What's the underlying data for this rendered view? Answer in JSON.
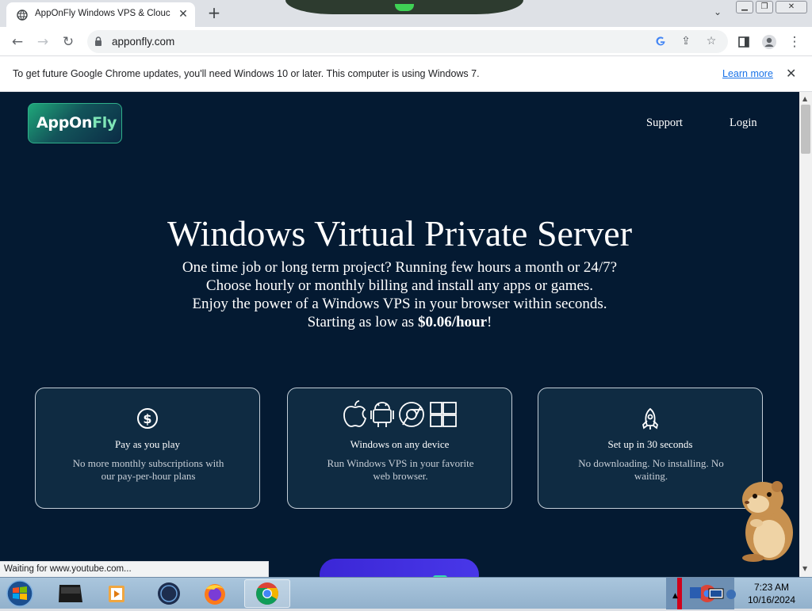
{
  "browser": {
    "tab_title": "AppOnFly Windows VPS & Clouc",
    "tab_close": "✕",
    "new_tab": "+",
    "url": "apponfly.com",
    "nav": {
      "back": "←",
      "forward": "→",
      "reload": "↻"
    },
    "infobar": {
      "message": "To get future Google Chrome updates, you'll need Windows 10 or later. This computer is using Windows 7.",
      "link": "Learn more",
      "close": "✕"
    },
    "status_text": "Waiting for www.youtube.com..."
  },
  "page": {
    "logo": {
      "part1": "AppOn",
      "part2": "Fly"
    },
    "nav": {
      "support": "Support",
      "login": "Login"
    },
    "hero": {
      "title": "Windows Virtual Private Server",
      "line1": "One time job or long term project? Running few hours a month or 24/7?",
      "line2": "Choose hourly or monthly billing and install any apps or games.",
      "line3": "Enjoy the power of a Windows VPS in your browser within seconds.",
      "line4_prefix": "Starting as low as ",
      "line4_price": "$0.06/hour",
      "line4_suffix": "!"
    },
    "cards": [
      {
        "icon": "dollar-icon",
        "title": "Pay as you play",
        "desc": "No more monthly subscriptions with our pay-per-hour plans"
      },
      {
        "icon": "platforms-icon",
        "title": "Windows on any device",
        "desc": "Run Windows VPS in your favorite web browser."
      },
      {
        "icon": "rocket-icon",
        "title": "Set up in 30 seconds",
        "desc": "No downloading. No installing. No waiting."
      }
    ]
  },
  "taskbar": {
    "time": "7:23 AM",
    "date": "10/16/2024"
  },
  "colors": {
    "page_bg": "#041a32",
    "card_bg": "#0f2b42",
    "accent_green": "#1fa87a",
    "cta": "#4030e0",
    "link_blue": "#1a73e8"
  }
}
